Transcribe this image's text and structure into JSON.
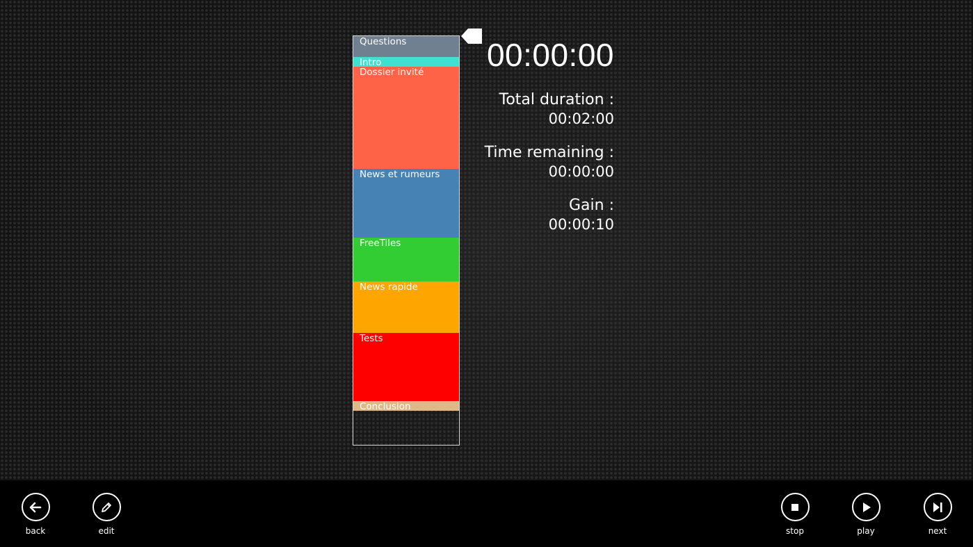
{
  "timeline": {
    "segments": [
      {
        "label": "Questions",
        "color": "#708090"
      },
      {
        "label": "Intro",
        "color": "#40e0d0"
      },
      {
        "label": "Dossier invité",
        "color": "#ff6347"
      },
      {
        "label": "News et rumeurs",
        "color": "#4682b4"
      },
      {
        "label": "FreeTiles",
        "color": "#32cd32"
      },
      {
        "label": "News rapide",
        "color": "#ffa500"
      },
      {
        "label": "Tests",
        "color": "#ff0000"
      },
      {
        "label": "Conclusion",
        "color": "#deb887"
      }
    ]
  },
  "clock": "00:00:00",
  "stats": {
    "total_label": "Total duration :",
    "total_value": "00:02:00",
    "remaining_label": "Time remaining :",
    "remaining_value": "00:00:00",
    "gain_label": "Gain :",
    "gain_value": "00:00:10"
  },
  "appbar": {
    "back": {
      "label": "back",
      "icon": "arrow-left-icon"
    },
    "edit": {
      "label": "edit",
      "icon": "pencil-icon"
    },
    "stop": {
      "label": "stop",
      "icon": "stop-icon"
    },
    "play": {
      "label": "play",
      "icon": "play-icon"
    },
    "next": {
      "label": "next",
      "icon": "skip-next-icon"
    }
  }
}
